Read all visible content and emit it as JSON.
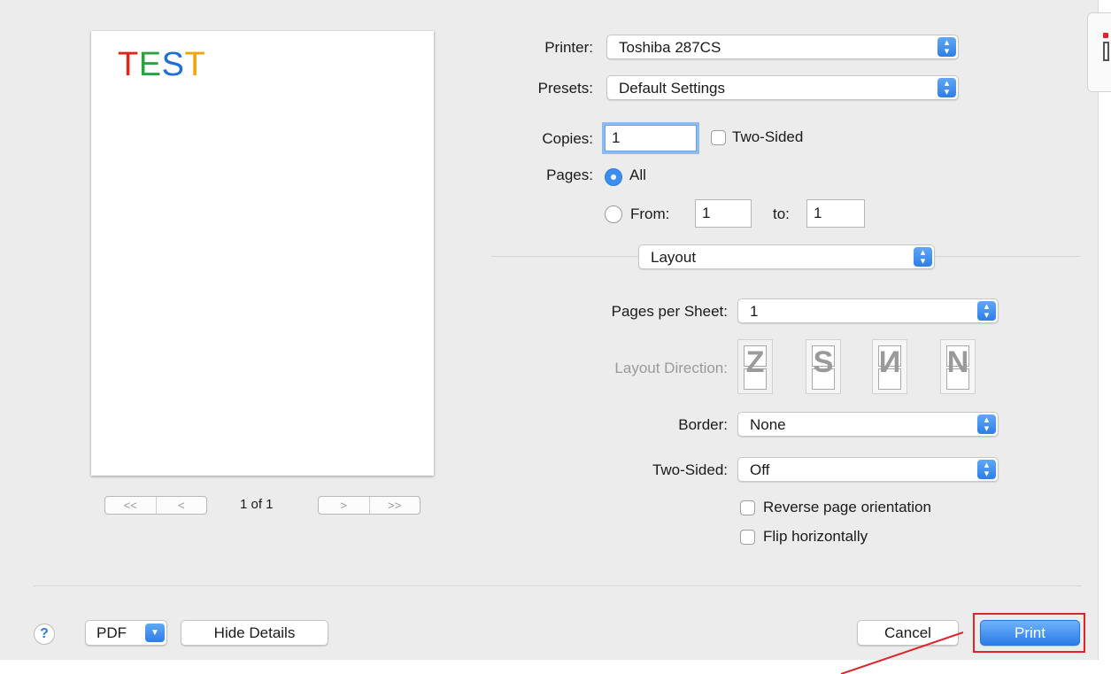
{
  "preview": {
    "test_letters": [
      {
        "ch": "T",
        "color": "#e2231a"
      },
      {
        "ch": "E",
        "color": "#2ea043"
      },
      {
        "ch": "S",
        "color": "#1f6fd6"
      },
      {
        "ch": "T",
        "color": "#f0a500"
      }
    ],
    "first_label": "<<",
    "prev_label": "<",
    "page_count": "1 of 1",
    "next_label": ">",
    "last_label": ">>"
  },
  "printer": {
    "label": "Printer:",
    "value": "Toshiba 287CS"
  },
  "presets": {
    "label": "Presets:",
    "value": "Default Settings"
  },
  "copies": {
    "label": "Copies:",
    "value": "1",
    "two_sided_label": "Two-Sided",
    "two_sided_checked": false
  },
  "pages": {
    "label": "Pages:",
    "all_label": "All",
    "all_selected": true,
    "from_label": "From:",
    "from_value": "1",
    "to_label": "to:",
    "to_value": "1"
  },
  "section": {
    "value": "Layout"
  },
  "layout": {
    "pages_per_sheet_label": "Pages per Sheet:",
    "pages_per_sheet_value": "1",
    "direction_label": "Layout Direction:",
    "direction_options": [
      "Z",
      "S",
      "N-reversed",
      "N"
    ],
    "border_label": "Border:",
    "border_value": "None",
    "two_sided_label": "Two-Sided:",
    "two_sided_value": "Off",
    "reverse_label": "Reverse page orientation",
    "reverse_checked": false,
    "flip_label": "Flip horizontally",
    "flip_checked": false
  },
  "footer": {
    "help_label": "?",
    "pdf_label": "PDF",
    "hide_details_label": "Hide Details",
    "cancel_label": "Cancel",
    "print_label": "Print"
  },
  "colors": {
    "accent": "#3b8ef0",
    "highlight_box": "#e0242c"
  }
}
